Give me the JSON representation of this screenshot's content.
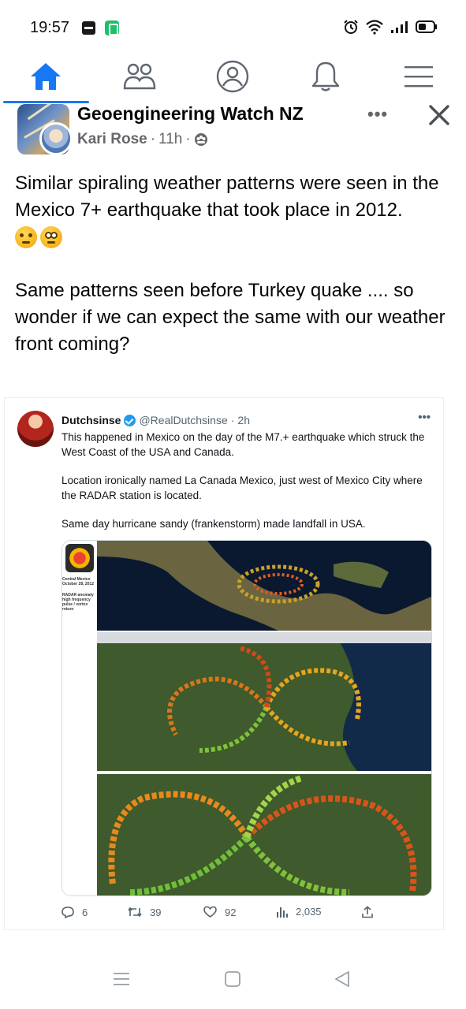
{
  "status_bar": {
    "time": "19:57",
    "icons": [
      "app-icon",
      "app-icon",
      "alarm-icon",
      "wifi-icon",
      "signal-icon",
      "battery-icon"
    ]
  },
  "nav": {
    "items": [
      {
        "name": "home",
        "icon": "home-icon",
        "active": true
      },
      {
        "name": "groups",
        "icon": "people-icon",
        "active": false
      },
      {
        "name": "profile",
        "icon": "profile-icon",
        "active": false
      },
      {
        "name": "notifications",
        "icon": "bell-icon",
        "active": false
      },
      {
        "name": "menu",
        "icon": "menu-icon",
        "active": false
      }
    ],
    "accent_color": "#1877f2"
  },
  "post": {
    "group_name": "Geoengineering Watch NZ",
    "author": "Kari Rose",
    "time_sep": "·",
    "time": "11h",
    "time_sep2": "·",
    "privacy_icon": "members-icon",
    "paragraph1": "Similar spiraling weather patterns were seen in the Mexico 7+ earthquake that took place in 2012.",
    "emojis": [
      "thinking-face",
      "flushed-face-with-monocle"
    ],
    "paragraph2": "Same patterns seen before Turkey quake .... so wonder if we can expect the same with our weather front coming?"
  },
  "tweet": {
    "name": "Dutchsinse",
    "handle": "@RealDutchsinse",
    "sep": "·",
    "time": "2h",
    "line1": "This happened in Mexico on the day of the M7.+ earthquake which struck the West Coast of the USA and Canada.",
    "line2": "Location ironically named La Canada Mexico, just west of Mexico City where the RADAR station is located.",
    "line3": "Same day hurricane sandy (frankenstorm) made landfall in USA.",
    "image": {
      "caption_title": "Central Mexico October 28, 2012",
      "caption_note": "RADAR anomaly high frequency pulse / vortex return"
    },
    "actions": {
      "replies": "6",
      "retweets": "39",
      "likes": "92",
      "views": "2,035"
    }
  }
}
